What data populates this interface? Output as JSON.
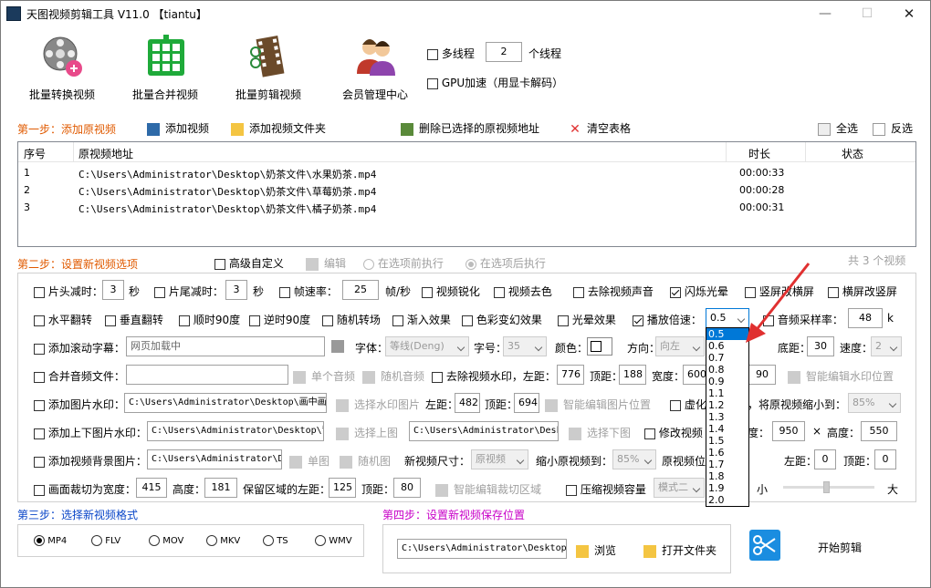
{
  "window": {
    "title": "天图视频剪辑工具 V11.0  【tiantu】",
    "min": "—",
    "max": "☐",
    "close": "✕"
  },
  "toolbar": {
    "batch_convert": "批量转换视频",
    "batch_merge": "批量合并视频",
    "batch_edit": "批量剪辑视频",
    "member": "会员管理中心",
    "multithread": "多线程",
    "threads": "2",
    "threads_unit": "个线程",
    "gpu": "GPU加速（用显卡解码）"
  },
  "step1": {
    "label": "第一步：添加原视频",
    "add_video": "添加视频",
    "add_folder": "添加视频文件夹",
    "delete_selected": "删除已选择的原视频地址",
    "clear_table": "清空表格",
    "select_all": "全选",
    "invert": "反选"
  },
  "table": {
    "headers": [
      "序号",
      "原视频地址",
      "时长",
      "状态"
    ],
    "rows": [
      [
        "1",
        "C:\\Users\\Administrator\\Desktop\\奶茶文件\\水果奶茶.mp4",
        "00:00:33",
        ""
      ],
      [
        "2",
        "C:\\Users\\Administrator\\Desktop\\奶茶文件\\草莓奶茶.mp4",
        "00:00:28",
        ""
      ],
      [
        "3",
        "C:\\Users\\Administrator\\Desktop\\奶茶文件\\橘子奶茶.mp4",
        "00:00:31",
        ""
      ]
    ],
    "count": "共 3 个视频"
  },
  "step2": {
    "label": "第二步：设置新视频选项",
    "advanced": "高级自定义",
    "edit": "编辑",
    "before": "在选项前执行",
    "after": "在选项后执行"
  },
  "opts": {
    "head_cut": "片头减时：",
    "head_val": "3",
    "sec": "秒",
    "tail_cut": "片尾减时：",
    "tail_val": "3",
    "fps": "帧速率：",
    "fps_val": "25",
    "fps_unit": "帧/秒",
    "sharpen": "视频锐化",
    "decolor": "视频去色",
    "remove_audio": "去除视频声音",
    "flash": "闪烁光晕",
    "v2h": "竖屏改横屏",
    "h2v": "横屏改竖屏",
    "hflip": "水平翻转",
    "vflip": "垂直翻转",
    "cw90": "顺时90度",
    "ccw90": "逆时90度",
    "rand_trans": "随机转场",
    "fade": "渐入效果",
    "color_fx": "色彩变幻效果",
    "light_fx": "光晕效果",
    "speed": "播放倍速：",
    "speed_val": "0.5",
    "sample": "音频采样率：",
    "sample_val": "48",
    "k": "k",
    "subtitle": "添加滚动字幕：",
    "subtitle_val": "网页加载中",
    "font": "字体：",
    "font_val": "等线(Deng)",
    "size": "字号：",
    "size_val": "35",
    "color": "颜色：",
    "direction": "方向：",
    "dir_val": "向左",
    "bottom": "底距：",
    "bottom_val": "30",
    "spd": "速度：",
    "spd_val": "2",
    "merge_audio": "合并音频文件：",
    "single_audio": "单个音频",
    "rand_audio": "随机音频",
    "remove_wm": "去除视频水印，左距：",
    "wm_left": "776",
    "top_dist": "顶距：",
    "wm_top": "188",
    "width": "宽度：",
    "wm_width": "600",
    "wm_h": "90",
    "smart_wm": "智能编辑水印位置",
    "img_wm": "添加图片水印：",
    "img_wm_path": "C:\\Users\\Administrator\\Desktop\\画中画",
    "choose_wm_img": "选择水印图片",
    "left": "左距：",
    "img_left": "482",
    "img_top": "694",
    "smart_img": "智能编辑图片位置",
    "blur": "虚化",
    "shrink": "，将原视频缩小到：",
    "shrink_val": "85%",
    "tb_wm": "添加上下图片水印：",
    "tb_path1": "C:\\Users\\Administrator\\Desktop\\背",
    "choose_top": "选择上图",
    "tb_path2": "C:\\Users\\Administrator\\Desk",
    "choose_bottom": "选择下图",
    "modify_res": "修改视频",
    "res_w_lbl": "度：",
    "res_w": "950",
    "x": "×",
    "res_h_lbl": "高度：",
    "res_h": "550",
    "bg_img": "添加视频背景图片：",
    "bg_path": "C:\\Users\\Administrator\\Deskt",
    "single_img": "单图",
    "rand_img": "随机图",
    "new_size": "新视频尺寸：",
    "new_size_val": "原视频",
    "shrink_to": "缩小原视频到：",
    "shrink_to_val": "85%",
    "orig_pos": "原视频位",
    "bg_left_val": "0",
    "bg_top_val": "0",
    "crop": "画面裁切为宽度：",
    "crop_w": "415",
    "height": "高度：",
    "crop_h": "181",
    "keep_left": "保留区域的左距：",
    "crop_left": "125",
    "crop_top": "80",
    "smart_crop": "智能编辑裁切区域",
    "compress": "压缩视频容量",
    "mode": "模式二",
    "small": "小",
    "big": "大"
  },
  "speed_options": [
    "0.5",
    "0.6",
    "0.7",
    "0.8",
    "0.9",
    "1.1",
    "1.2",
    "1.3",
    "1.4",
    "1.5",
    "1.6",
    "1.7",
    "1.8",
    "1.9",
    "2.0"
  ],
  "step3": {
    "label": "第三步：选择新视频格式",
    "formats": [
      "MP4",
      "FLV",
      "MOV",
      "MKV",
      "TS",
      "WMV"
    ]
  },
  "step4": {
    "label": "第四步：设置新视频保存位置",
    "path": "C:\\Users\\Administrator\\Desktop\\",
    "browse": "浏览",
    "open_folder": "打开文件夹",
    "start": "开始剪辑"
  }
}
